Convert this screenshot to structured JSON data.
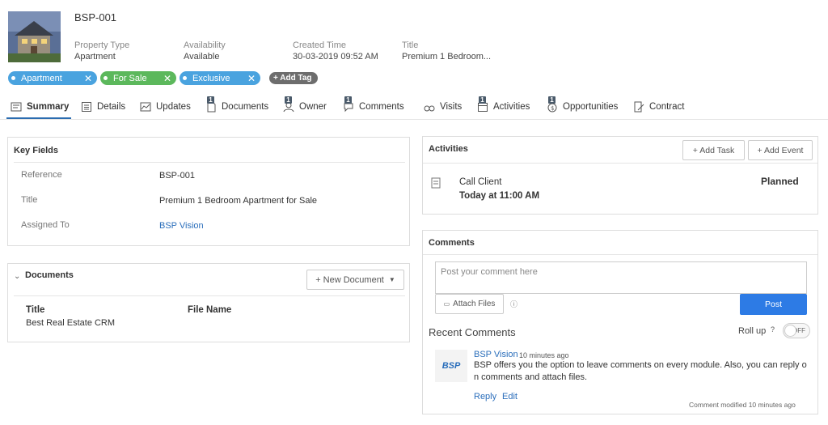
{
  "record": {
    "id": "BSP-001",
    "fields": [
      {
        "label": "Property Type",
        "value": "Apartment"
      },
      {
        "label": "Availability",
        "value": "Available"
      },
      {
        "label": "Created Time",
        "value": "30-03-2019 09:52 AM"
      },
      {
        "label": "Title",
        "value": "Premium 1 Bedroom..."
      }
    ]
  },
  "tags": [
    {
      "label": "Apartment",
      "color": "#4aa3df"
    },
    {
      "label": "For Sale",
      "color": "#5cb85c"
    },
    {
      "label": "Exclusive",
      "color": "#4aa3df"
    }
  ],
  "add_tag_label": "+ Add Tag",
  "tabs": [
    {
      "label": "Summary",
      "icon": "summary-icon",
      "active": true
    },
    {
      "label": "Details",
      "icon": "details-icon"
    },
    {
      "label": "Updates",
      "icon": "updates-icon"
    },
    {
      "label": "Documents",
      "icon": "document-icon",
      "badge": "1"
    },
    {
      "label": "Owner",
      "icon": "owner-icon",
      "badge": "1"
    },
    {
      "label": "Comments",
      "icon": "comments-icon",
      "badge": "1"
    },
    {
      "label": "Visits",
      "icon": "visits-icon"
    },
    {
      "label": "Activities",
      "icon": "activities-icon",
      "badge": "1"
    },
    {
      "label": "Opportunities",
      "icon": "opportunities-icon",
      "badge": "1"
    },
    {
      "label": "Contract",
      "icon": "contract-icon"
    }
  ],
  "key_fields": {
    "title": "Key Fields",
    "rows": [
      {
        "label": "Reference",
        "value": "BSP-001"
      },
      {
        "label": "Title",
        "value": "Premium 1 Bedroom Apartment for Sale"
      },
      {
        "label": "Assigned To",
        "value": "BSP Vision"
      }
    ]
  },
  "documents": {
    "title": "Documents",
    "new_button": "+ New Document",
    "columns": [
      "Title",
      "File Name"
    ],
    "rows": [
      {
        "title": "Best Real Estate CRM",
        "file": ""
      }
    ]
  },
  "activities": {
    "title": "Activities",
    "add_task": "+ Add Task",
    "add_event": "+ Add Event",
    "item": {
      "title": "Call Client",
      "when": "Today at 11:00 AM",
      "status": "Planned"
    }
  },
  "comments": {
    "title": "Comments",
    "placeholder": "Post your comment here",
    "attach": "Attach Files",
    "post": "Post",
    "recent_title": "Recent Comments",
    "rollup_label": "Roll up",
    "toggle_state": "OFF",
    "item": {
      "author": "BSP Vision",
      "time": "10 minutes ago",
      "text_line1": "BSP offers you the option to leave comments on every module. Also, you can reply o",
      "text_line2": "n comments and attach files.",
      "reply": "Reply",
      "edit": "Edit",
      "modified": "Comment modified 10 minutes ago",
      "avatar_text": "BSP"
    }
  }
}
